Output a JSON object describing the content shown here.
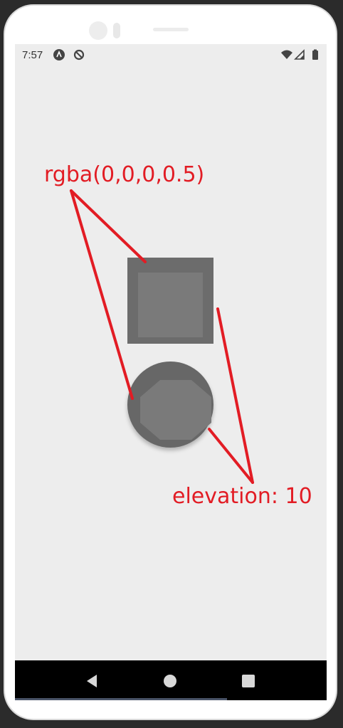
{
  "status_bar": {
    "time": "7:57",
    "left_icons": [
      "android-accessibility-icon",
      "sync-disabled-icon"
    ],
    "right_icons": [
      "wifi-icon",
      "cellular-signal-icon",
      "battery-icon"
    ]
  },
  "content": {
    "square_shape": "square-view",
    "circle_shape": "circle-view"
  },
  "annotations": {
    "top_label": "rgba(0,0,0,0.5)",
    "bottom_label": "elevation: 10"
  },
  "nav_bar": {
    "buttons": [
      "back-button",
      "home-button",
      "recents-button"
    ]
  },
  "colors": {
    "screen_bg": "#ededed",
    "shape_outer": "#6c6c6c",
    "shape_inner": "#7a7a7a",
    "annotation": "#e21c24",
    "nav_bar_bg": "#000000"
  }
}
